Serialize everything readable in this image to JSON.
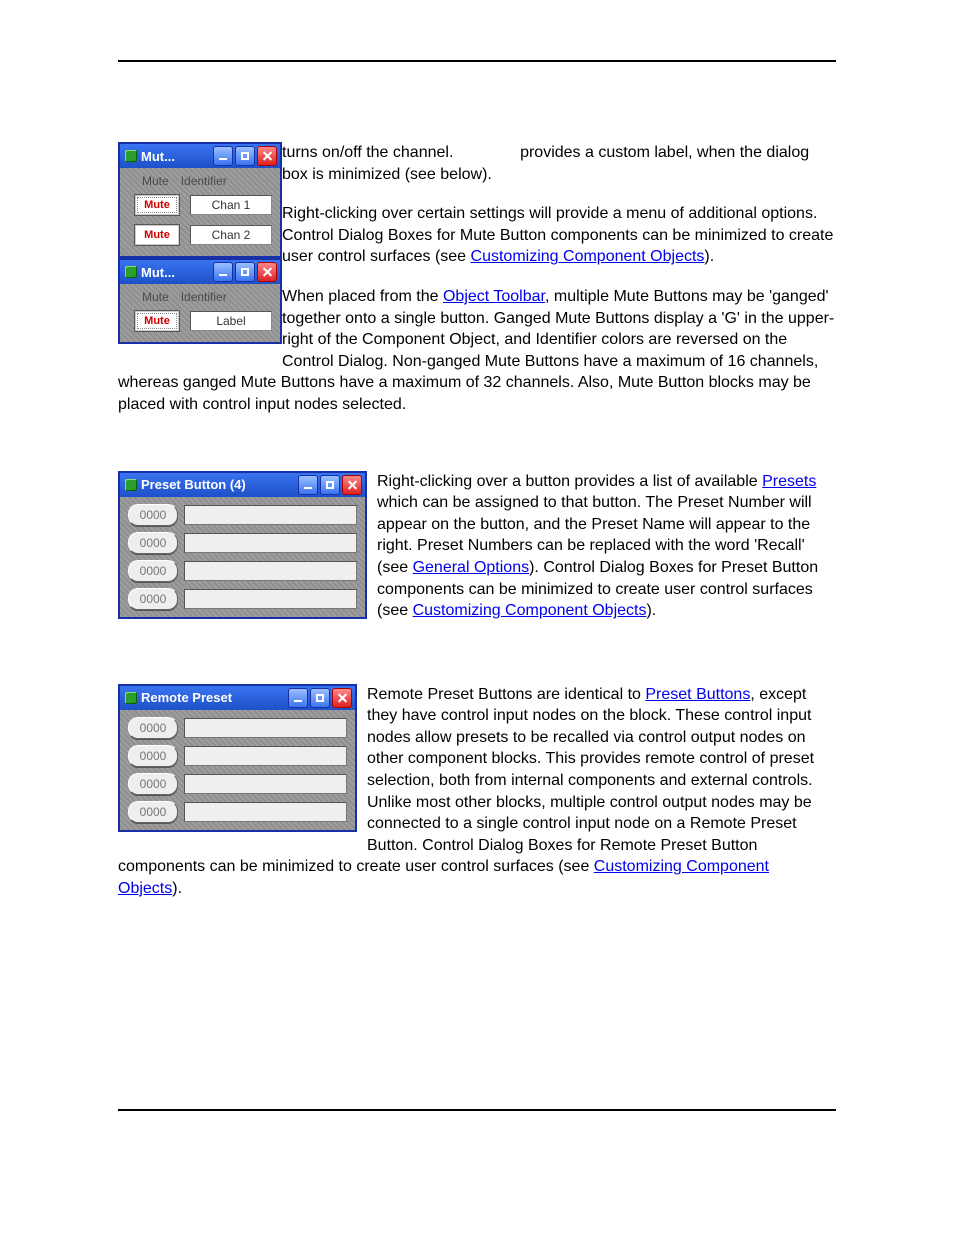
{
  "sep": ", ",
  "punct": {
    "period_paren": ").",
    "close_paren": ")."
  },
  "mute": {
    "win1_title": "Mut...",
    "win2_title": "Mut...",
    "hdr_mute": "Mute",
    "hdr_ident": "Identifier",
    "btn_label": "Mute",
    "chan1": "Chan 1",
    "chan2": "Chan 2",
    "label_field": "Label",
    "text1a": " turns on/off the channel. ",
    "text1b": " provides a custom label, when the dialog box is minimized (see below).",
    "text2a": "Right-clicking over certain settings will provide a menu of additional options. Control Dialog Boxes for Mute Button components can be minimized to create user control surfaces (see ",
    "link_cco": "Customizing Component Objects",
    "text3a": "When placed from the ",
    "link_toolbar": "Object Toolbar",
    "text3b": ", multiple Mute Buttons may be 'ganged' together onto a single button. Ganged Mute Buttons display a 'G' in the upper-right of the Component Object, and Identifier colors are reversed on the Control Dialog. Non-ganged Mute Buttons have a maximum of 16 channels, whereas ganged Mute Buttons have a maximum of 32 channels. Also, Mute Button blocks may be placed with control input nodes selected."
  },
  "preset": {
    "title": "Preset Button (4)",
    "btn": "0000",
    "text1": "Right-clicking over a button provides a list of available ",
    "link_presets": "Presets",
    "text2": " which can be assigned to that button. The Preset Number will appear on the button, and the Preset Name will appear to the right. Preset Numbers can be replaced with the word 'Recall' (see ",
    "link_gen": "General Options",
    "text3": "). Control Dialog Boxes for Preset Button components can be minimized to create user control surfaces (see ",
    "link_cco": "Customizing Component Objects"
  },
  "remote": {
    "title": "Remote Preset",
    "btn": "0000",
    "text1": "Remote Preset Buttons are identical to ",
    "link_pb": "Preset Buttons",
    "text2": ", except they have control input nodes on the block. These control input nodes allow presets to be recalled via control output nodes on other component blocks. This provides remote control of preset selection, both from internal components and external controls. Unlike most other blocks, multiple control output nodes may be connected to a single control input node on a Remote Preset Button. Control Dialog Boxes for Remote Preset Button components can be minimized to create user control surfaces (see ",
    "link_cco": "Customizing Component Objects"
  }
}
